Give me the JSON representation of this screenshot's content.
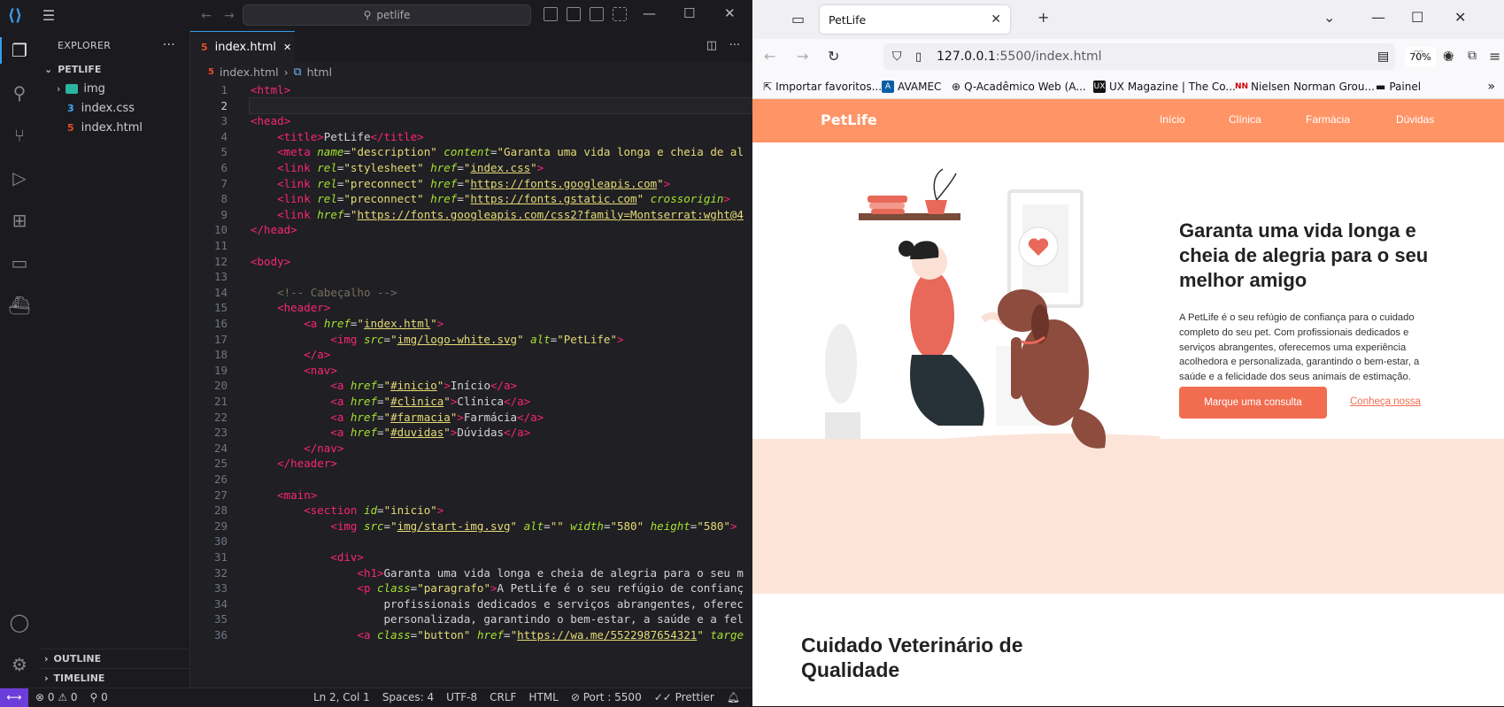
{
  "vscode": {
    "search": "petlife",
    "explorer": {
      "title": "EXPLORER",
      "more": "···",
      "root": "PETLIFE",
      "items": [
        {
          "label": "img",
          "kind": "folder",
          "icon": "folder-icon"
        },
        {
          "label": "index.css",
          "kind": "css",
          "icon": "css-file-icon"
        },
        {
          "label": "index.html",
          "kind": "html",
          "icon": "html-file-icon"
        }
      ]
    },
    "outline": "OUTLINE",
    "timeline": "TIMELINE",
    "tab": {
      "label": "index.html",
      "close": "✕"
    },
    "breadcrumb": {
      "file": "index.html",
      "symbol": "html"
    },
    "code_lines": [
      "<span class='t'>&lt;html&gt;</span>",
      "",
      "<span class='t'>&lt;head&gt;</span>",
      "    <span class='t'>&lt;title&gt;</span>PetLife<span class='t'>&lt;/title&gt;</span>",
      "    <span class='t'>&lt;meta</span> <span class='a'>name</span>=<span class='s'>\"description\"</span> <span class='a'>content</span>=<span class='s'>\"Garanta uma vida longa e cheia de al</span>",
      "    <span class='t'>&lt;link</span> <span class='a'>rel</span>=<span class='s'>\"stylesheet\"</span> <span class='a'>href</span>=<span class='s'>\"<span class='u'>index.css</span>\"</span><span class='t'>&gt;</span>",
      "    <span class='t'>&lt;link</span> <span class='a'>rel</span>=<span class='s'>\"preconnect\"</span> <span class='a'>href</span>=<span class='s'>\"<span class='u'>https://fonts.googleapis.com</span>\"</span><span class='t'>&gt;</span>",
      "    <span class='t'>&lt;link</span> <span class='a'>rel</span>=<span class='s'>\"preconnect\"</span> <span class='a'>href</span>=<span class='s'>\"<span class='u'>https://fonts.gstatic.com</span>\"</span> <span class='a'>crossorigin</span><span class='t'>&gt;</span>",
      "    <span class='t'>&lt;link</span> <span class='a'>href</span>=<span class='s'>\"<span class='u'>https://fonts.googleapis.com/css2?family=Montserrat:wght@4</span></span>",
      "<span class='t'>&lt;/head&gt;</span>",
      "",
      "<span class='t'>&lt;body&gt;</span>",
      "",
      "    <span class='c'>&lt;!-- Cabeçalho --&gt;</span>",
      "    <span class='t'>&lt;header&gt;</span>",
      "        <span class='t'>&lt;a</span> <span class='a'>href</span>=<span class='s'>\"<span class='u'>index.html</span>\"</span><span class='t'>&gt;</span>",
      "            <span class='t'>&lt;img</span> <span class='a'>src</span>=<span class='s'>\"<span class='u'>img/logo-white.svg</span>\"</span> <span class='a'>alt</span>=<span class='s'>\"PetLife\"</span><span class='t'>&gt;</span>",
      "        <span class='t'>&lt;/a&gt;</span>",
      "        <span class='t'>&lt;nav&gt;</span>",
      "            <span class='t'>&lt;a</span> <span class='a'>href</span>=<span class='s'>\"<span class='u'>#inicio</span>\"</span><span class='t'>&gt;</span>Início<span class='t'>&lt;/a&gt;</span>",
      "            <span class='t'>&lt;a</span> <span class='a'>href</span>=<span class='s'>\"<span class='u'>#clinica</span>\"</span><span class='t'>&gt;</span>Clínica<span class='t'>&lt;/a&gt;</span>",
      "            <span class='t'>&lt;a</span> <span class='a'>href</span>=<span class='s'>\"<span class='u'>#farmacia</span>\"</span><span class='t'>&gt;</span>Farmácia<span class='t'>&lt;/a&gt;</span>",
      "            <span class='t'>&lt;a</span> <span class='a'>href</span>=<span class='s'>\"<span class='u'>#duvidas</span>\"</span><span class='t'>&gt;</span>Dúvidas<span class='t'>&lt;/a&gt;</span>",
      "        <span class='t'>&lt;/nav&gt;</span>",
      "    <span class='t'>&lt;/header&gt;</span>",
      "",
      "    <span class='t'>&lt;main&gt;</span>",
      "        <span class='t'>&lt;section</span> <span class='a'>id</span>=<span class='s'>\"inicio\"</span><span class='t'>&gt;</span>",
      "            <span class='t'>&lt;img</span> <span class='a'>src</span>=<span class='s'>\"<span class='u'>img/start-img.svg</span>\"</span> <span class='a'>alt</span>=<span class='s'>\"\"</span> <span class='a'>width</span>=<span class='s'>\"580\"</span> <span class='a'>height</span>=<span class='s'>\"580\"</span><span class='t'>&gt;</span>",
      "",
      "            <span class='t'>&lt;div&gt;</span>",
      "                <span class='t'>&lt;h1&gt;</span>Garanta uma vida longa e cheia de alegria para o seu m",
      "                <span class='t'>&lt;p</span> <span class='a'>class</span>=<span class='s'>\"paragrafo\"</span><span class='t'>&gt;</span>A PetLife é o seu refúgio de confianç",
      "                    profissionais dedicados e serviços abrangentes, oferec",
      "                    personalizada, garantindo o bem-estar, a saúde e a fel",
      "                <span class='t'>&lt;a</span> <span class='a'>class</span>=<span class='s'>\"button\"</span> <span class='a'>href</span>=<span class='s'>\"<span class='u'>https://wa.me/5522987654321</span>\"</span> <span class='a'>targe</span>"
    ],
    "status": {
      "errors": "⊗ 0 ⚠ 0",
      "ports": "⚲ 0",
      "position": "Ln 2, Col 1",
      "spaces": "Spaces: 4",
      "encoding": "UTF-8",
      "eol": "CRLF",
      "lang": "HTML",
      "port": "⊘ Port : 5500",
      "prettier": "✓✓ Prettier"
    }
  },
  "firefox": {
    "tab_title": "PetLife",
    "url_host": "127.0.0.1",
    "url_path": ":5500/index.html",
    "zoom": "70%",
    "bookmarks": [
      "Importar favoritos...",
      "AVAMEC",
      "Q-Acadêmico Web (A...",
      "UX Magazine | The Co...",
      "Nielsen Norman Grou...",
      "Painel"
    ],
    "site": {
      "logo": "PetLife",
      "nav": [
        "Início",
        "Clínica",
        "Farmácia",
        "Dúvidas"
      ],
      "headline": "Garanta uma vida longa e cheia de alegria para o seu melhor amigo",
      "paragraph": "A PetLife é o seu refúgio de confiança para o cuidado completo do seu pet. Com profissionais dedicados e serviços abrangentes, oferecemos uma experiência acolhedora e personalizada, garantindo o bem-estar, a saúde e a felicidade dos seus animais de estimação.",
      "cta": "Marque uma consulta",
      "secondary": "Conheça nossa",
      "section2": "Cuidado Veterinário de Qualidade"
    }
  },
  "colors": {
    "accent": "#ff9466",
    "button": "#f26c4f",
    "hero_bg": "#fde4d9",
    "vscode_blue": "#3b9ce9"
  }
}
